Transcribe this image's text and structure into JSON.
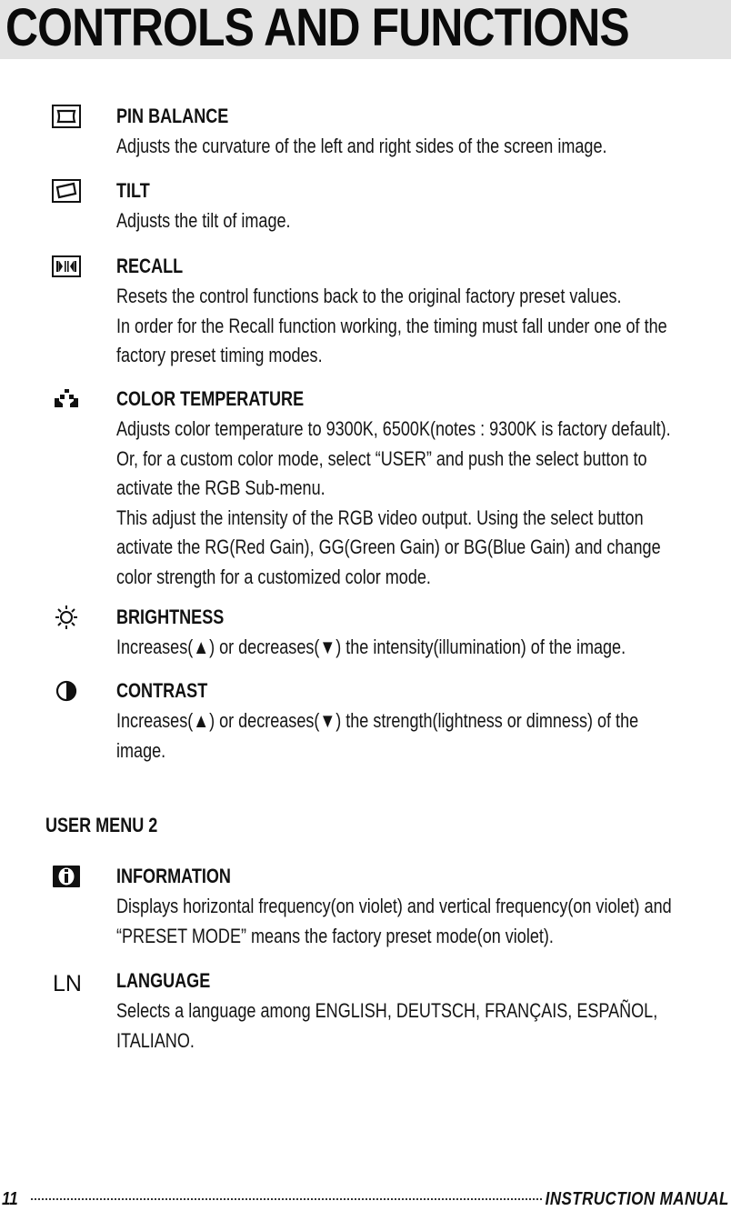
{
  "header": {
    "title": "CONTROLS AND FUNCTIONS"
  },
  "items": [
    {
      "icon": "pin-balance-icon",
      "heading": "PIN BALANCE",
      "lines": [
        "Adjusts the curvature of the left and right sides of the screen image."
      ]
    },
    {
      "icon": "tilt-icon",
      "heading": "TILT",
      "lines": [
        "Adjusts the tilt of image."
      ]
    },
    {
      "icon": "recall-icon",
      "heading": "RECALL",
      "lines": [
        "Resets the control functions back to the original factory preset values.",
        "In order for the Recall function working, the timing must fall under one of the",
        "factory preset timing modes."
      ]
    },
    {
      "icon": "color-temperature-icon",
      "heading": "COLOR TEMPERATURE",
      "lines": [
        "Adjusts color temperature to 9300K, 6500K(notes : 9300K is factory default).",
        "Or, for a custom color mode, select “USER” and push the select button to",
        "activate the RGB Sub-menu.",
        "This adjust the intensity of the RGB video output. Using the select button",
        "activate the RG(Red Gain), GG(Green Gain) or BG(Blue Gain) and change",
        "color strength for a customized color mode."
      ]
    },
    {
      "icon": "brightness-icon",
      "heading": "BRIGHTNESS",
      "lines": [
        "Increases(▲) or decreases(▼) the intensity(illumination) of the image."
      ]
    },
    {
      "icon": "contrast-icon",
      "heading": "CONTRAST",
      "lines": [
        "Increases(▲) or decreases(▼) the strength(lightness or dimness) of the",
        "image."
      ]
    }
  ],
  "user_menu_2": {
    "heading": "USER MENU 2",
    "items": [
      {
        "icon": "information-icon",
        "heading": "INFORMATION",
        "lines": [
          "Displays horizontal frequency(on violet) and vertical frequency(on violet) and",
          "“PRESET MODE” means the factory preset mode(on violet)."
        ]
      },
      {
        "icon": "language-icon",
        "icon_text": "LN",
        "heading": "LANGUAGE",
        "lines": [
          "Selects a language among ENGLISH, DEUTSCH, FRANÇAIS, ESPAÑOL,",
          "ITALIANO."
        ]
      }
    ]
  },
  "footer": {
    "page_number": "11",
    "manual_title": "INSTRUCTION  MANUAL"
  }
}
